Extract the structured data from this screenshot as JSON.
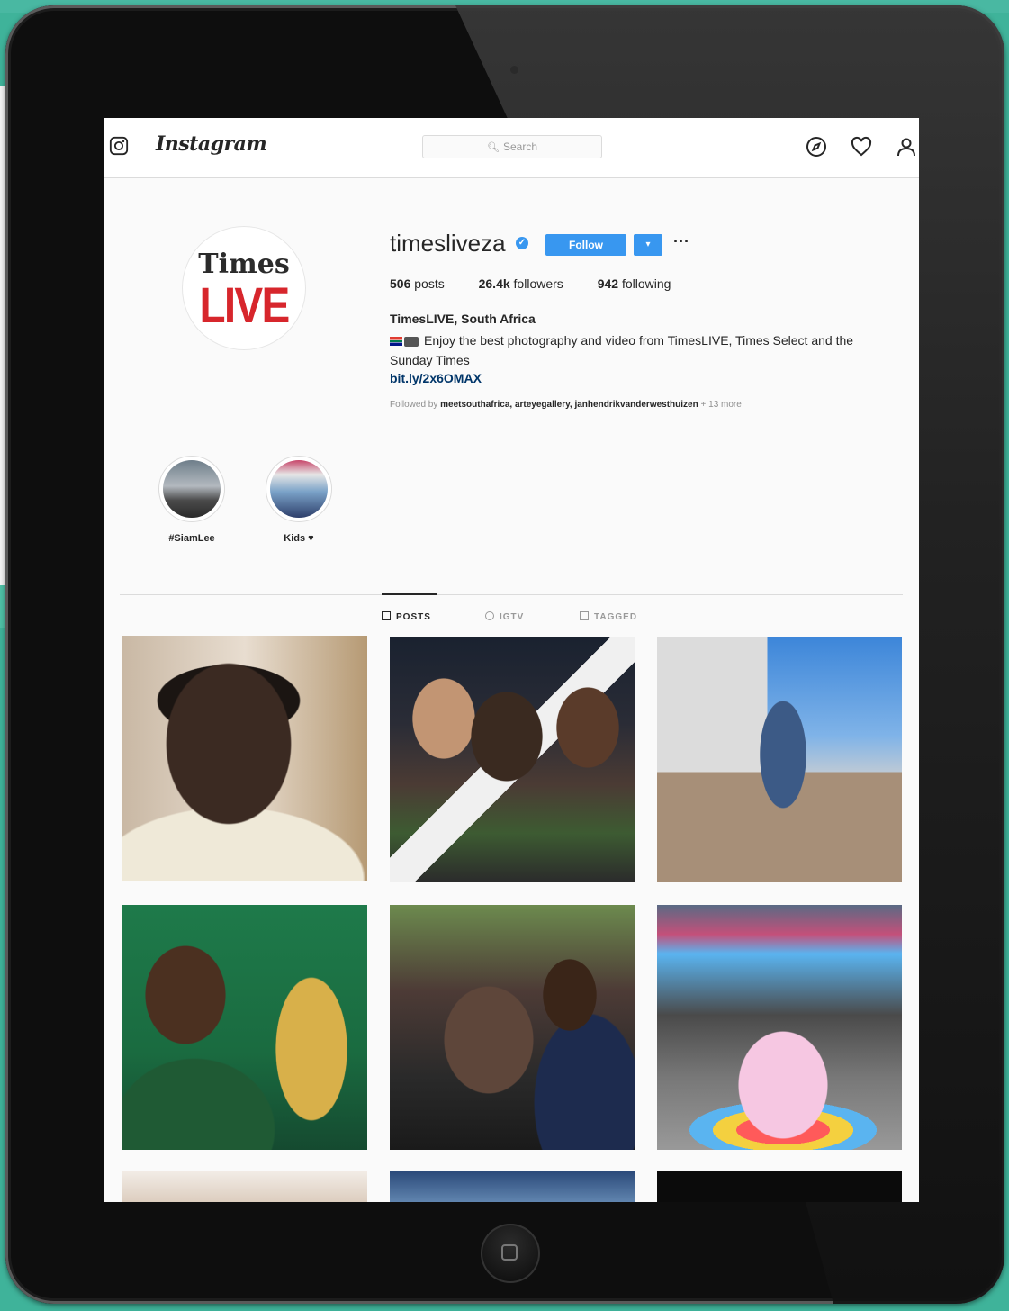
{
  "app": {
    "wordmark": "Instagram",
    "search_placeholder": "Search"
  },
  "profile": {
    "avatar_logo_line1": "Times",
    "avatar_logo_line2": "LIVE",
    "username": "timesliveza",
    "follow_label": "Follow",
    "dropdown_glyph": "▾",
    "more_glyph": "···",
    "stats": [
      {
        "count": "506",
        "label": "posts"
      },
      {
        "count": "26.4k",
        "label": "followers"
      },
      {
        "count": "942",
        "label": "following"
      }
    ],
    "full_name": "TimesLIVE, South Africa",
    "bio": "Enjoy the best photography and video from TimesLIVE, Times Select and the Sunday Times",
    "link": "bit.ly/2x6OMAX",
    "followed_by_prefix": "Followed by",
    "followed_by_names": "meetsouthafrica, arteyegallery, janhendrikvanderwesthuizen",
    "followed_by_more": "+ 13 more"
  },
  "highlights": [
    {
      "label": "#SiamLee"
    },
    {
      "label": "Kids ♥"
    }
  ],
  "tabs": [
    {
      "label": "POSTS",
      "active": true
    },
    {
      "label": "IGTV",
      "active": false
    },
    {
      "label": "TAGGED",
      "active": false
    }
  ],
  "icons": {
    "logo": "instagram-glyph-icon",
    "explore": "compass-icon",
    "activity": "heart-icon",
    "profile": "user-icon",
    "verified": "verified-badge-icon"
  },
  "colors": {
    "accent": "#3897f0",
    "brand_red": "#d7262c",
    "background": "#3fb39a"
  }
}
